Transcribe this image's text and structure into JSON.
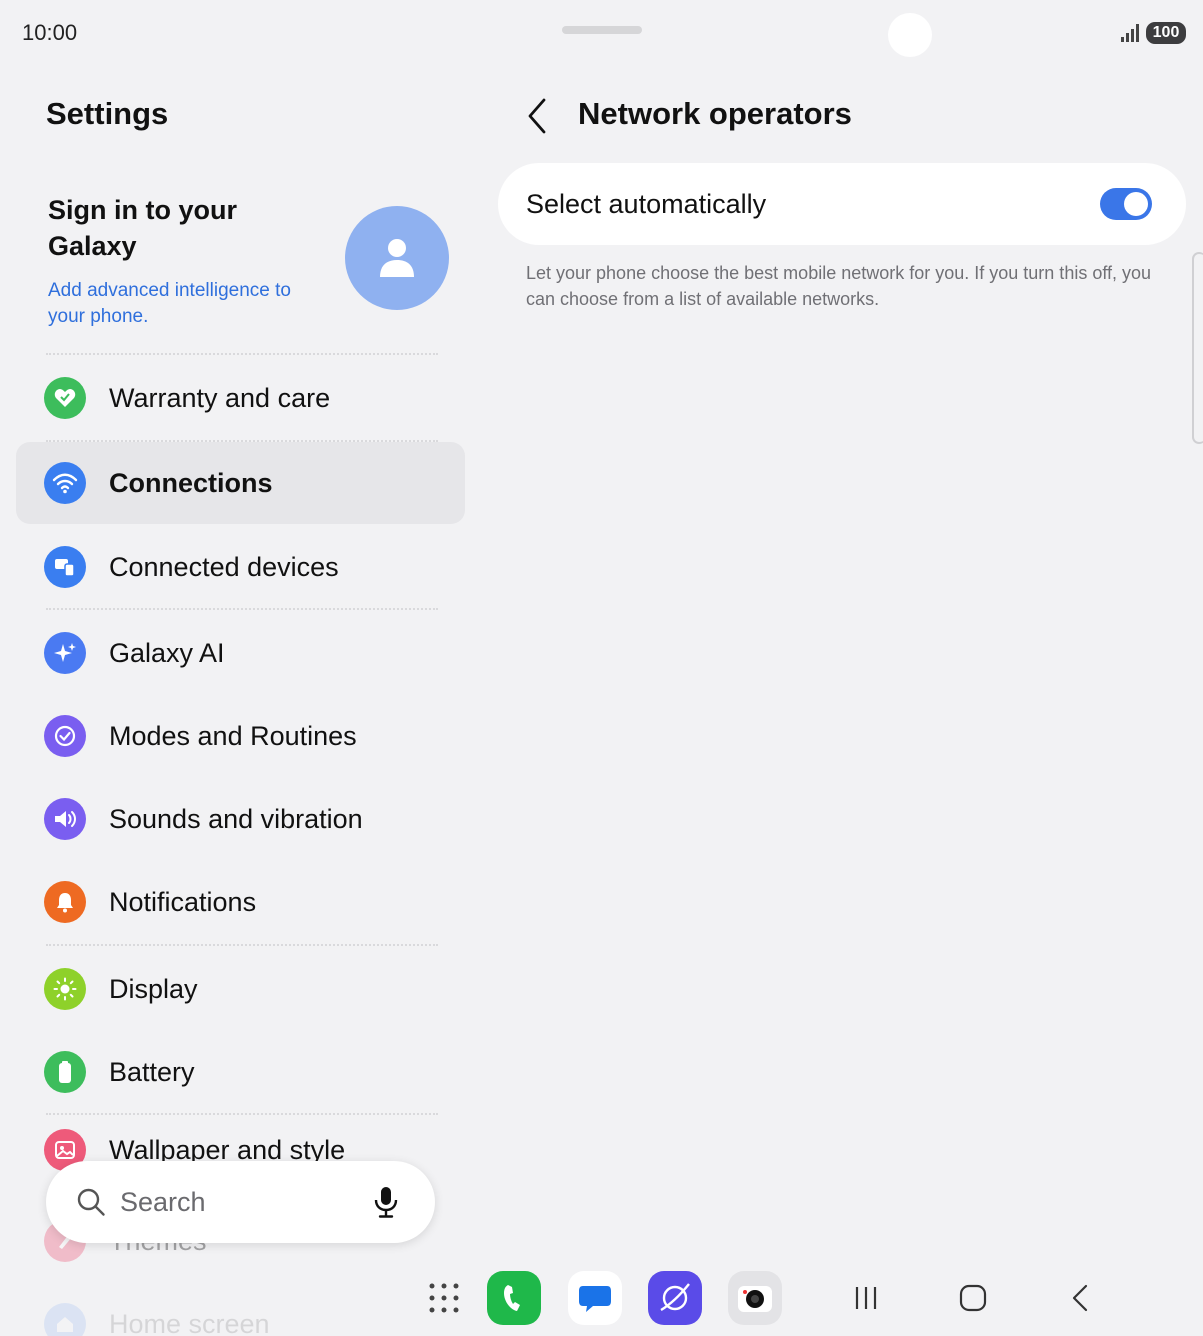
{
  "status_bar": {
    "time": "10:00",
    "battery": "100"
  },
  "left_pane": {
    "title": "Settings",
    "account": {
      "title": "Sign in to your Galaxy",
      "subtitle": "Add advanced intelligence to your phone."
    },
    "items": [
      {
        "label": "Warranty and care",
        "icon": "heart-shield-icon",
        "color": "#3dbd5c"
      },
      {
        "label": "Connections",
        "icon": "wifi-icon",
        "color": "#3a7ef0"
      },
      {
        "label": "Connected devices",
        "icon": "devices-icon",
        "color": "#3a7ef0"
      },
      {
        "label": "Galaxy AI",
        "icon": "sparkle-icon",
        "color": "#4a7af2"
      },
      {
        "label": "Modes and Routines",
        "icon": "check-circle-icon",
        "color": "#7a5ef0"
      },
      {
        "label": "Sounds and vibration",
        "icon": "speaker-icon",
        "color": "#7a5ef0"
      },
      {
        "label": "Notifications",
        "icon": "bell-icon",
        "color": "#ee6a22"
      },
      {
        "label": "Display",
        "icon": "sun-icon",
        "color": "#8ed12a"
      },
      {
        "label": "Battery",
        "icon": "battery-icon",
        "color": "#3dbd5c"
      },
      {
        "label": "Wallpaper and style",
        "icon": "image-icon",
        "color": "#ee5a7a"
      },
      {
        "label": "Themes",
        "icon": "brush-icon",
        "color": "#ee5a7a"
      },
      {
        "label": "Home screen",
        "icon": "home-icon",
        "color": "#3a7ef0"
      }
    ],
    "search": {
      "placeholder": "Search"
    }
  },
  "right_pane": {
    "title": "Network operators",
    "select_auto": {
      "label": "Select automatically",
      "enabled": true
    },
    "help": "Let your phone choose the best mobile network for you. If you turn this off, you can choose from a list of available networks."
  },
  "colors": {
    "accent": "#3a76e8",
    "link": "#2f6fdc"
  }
}
